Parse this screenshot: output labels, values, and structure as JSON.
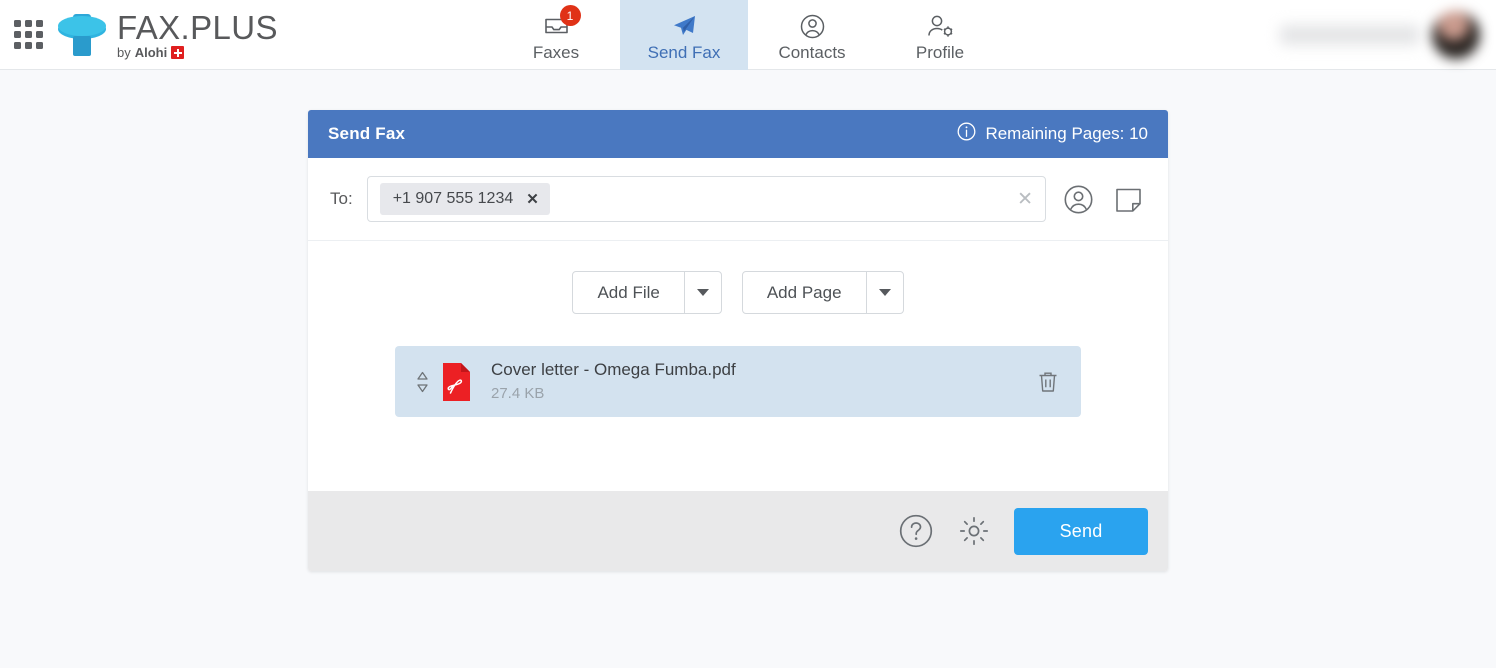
{
  "brand": {
    "name": "FAX.PLUS",
    "by_prefix": "by",
    "by_company": "Alohi",
    "apps_icon": "apps-grid-icon",
    "logo_icon": "faxplus-logo-icon",
    "flag_icon": "swiss-flag-icon"
  },
  "nav": {
    "tabs": [
      {
        "label": "Faxes",
        "icon": "inbox-tray-icon",
        "badge": "1",
        "active": false
      },
      {
        "label": "Send Fax",
        "icon": "paper-plane-icon",
        "badge": "",
        "active": true
      },
      {
        "label": "Contacts",
        "icon": "person-circle-icon",
        "badge": "",
        "active": false
      },
      {
        "label": "Profile",
        "icon": "person-gear-icon",
        "badge": "",
        "active": false
      }
    ],
    "account_name_redacted": "",
    "avatar_icon": "user-avatar"
  },
  "card": {
    "title": "Send Fax",
    "remaining_pages": "Remaining Pages: 10",
    "info_icon": "info-circle-icon"
  },
  "to": {
    "label": "To:",
    "recipients": [
      {
        "value": "+1 907 555 1234",
        "remove_icon": "chip-remove-icon"
      }
    ],
    "input_value": "",
    "input_placeholder": "",
    "clear_icon": "clear-input-icon",
    "contacts_icon": "contacts-person-icon",
    "note_icon": "note-page-icon"
  },
  "actions": {
    "add_file": "Add File",
    "add_file_caret_icon": "chevron-down-icon",
    "add_page": "Add Page",
    "add_page_caret_icon": "chevron-down-icon"
  },
  "files": [
    {
      "name": "Cover letter - Omega Fumba.pdf",
      "size": "27.4 KB",
      "type_icon": "pdf-file-icon",
      "drag_icon": "drag-reorder-icon",
      "delete_icon": "trash-icon"
    }
  ],
  "footer": {
    "help_icon": "help-circle-icon",
    "settings_icon": "gear-icon",
    "send_label": "Send"
  },
  "colors": {
    "header_blue": "#4a78c0",
    "send_blue": "#2aa3ef",
    "active_tab_bg": "#d3e3f1",
    "active_tab_text": "#3f6fb5",
    "file_row_bg": "#d3e2ef",
    "badge_red": "#e03217",
    "pdf_red": "#ec2024",
    "page_bg": "#f8f9fb",
    "footer_bg": "#e9e9ea"
  }
}
